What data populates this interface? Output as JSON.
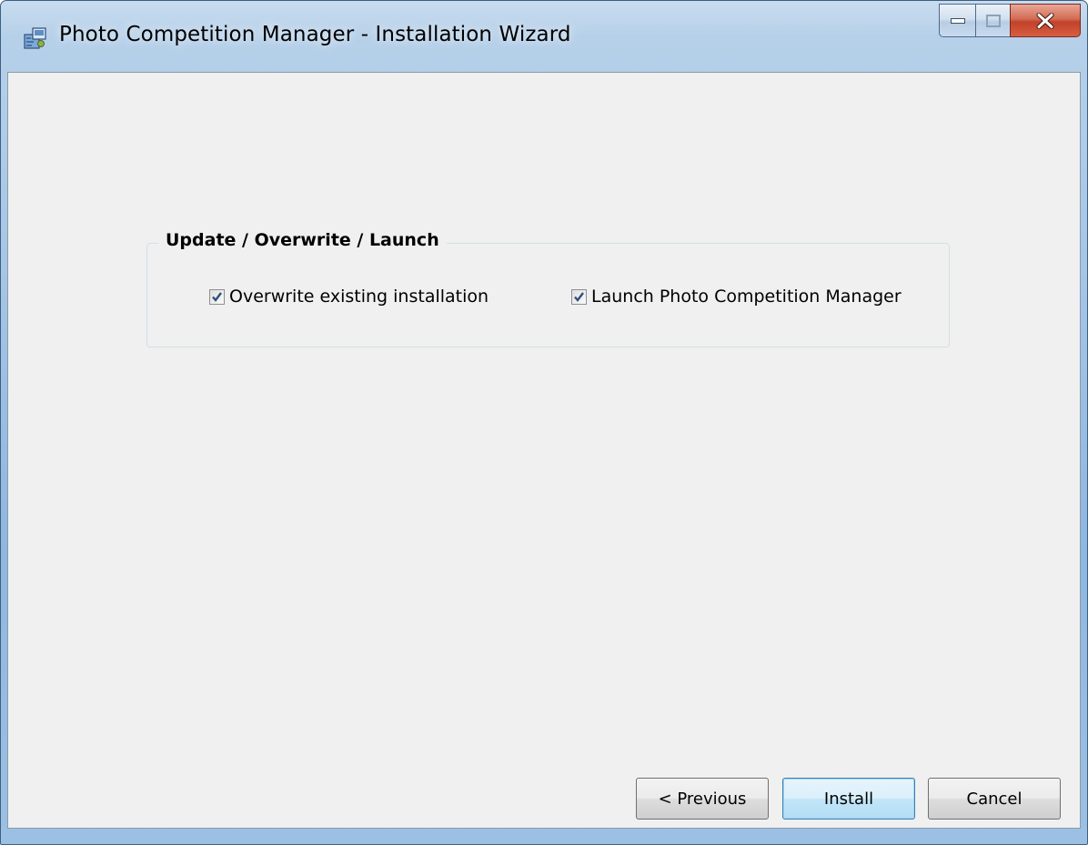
{
  "window": {
    "title": "Photo Competition Manager - Installation Wizard",
    "icon": "installer-package-icon"
  },
  "caption_buttons": {
    "minimize": "minimize-icon",
    "maximize": "maximize-icon",
    "close": "close-icon"
  },
  "group": {
    "legend": "Update / Overwrite / Launch",
    "options": [
      {
        "label": "Overwrite existing installation",
        "checked": true
      },
      {
        "label": "Launch Photo Competition Manager",
        "checked": true
      }
    ]
  },
  "buttons": {
    "previous": "< Previous",
    "install": "Install",
    "cancel": "Cancel"
  },
  "colors": {
    "title_bar": "#b6d0e9",
    "client_background": "#f0f0f0",
    "close_button": "#c2412a",
    "default_button_border": "#3c7fb1",
    "check_mark": "#2f4f7f"
  }
}
